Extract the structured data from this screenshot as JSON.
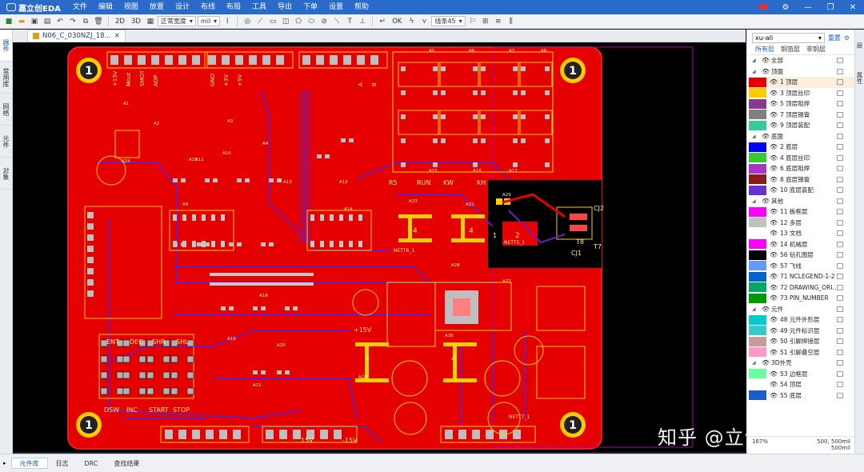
{
  "app": {
    "name": "嘉立创EDA"
  },
  "menu": [
    "文件",
    "编辑",
    "视图",
    "放置",
    "设计",
    "布线",
    "布局",
    "工具",
    "导出",
    "下单",
    "设置",
    "帮助"
  ],
  "toolbar": {
    "view2d": "2D",
    "view3d": "3D",
    "mode": "正常宽度",
    "unit": "mil",
    "track": "线条45"
  },
  "document_tab": {
    "title": "N06_C_030NZJ_18..."
  },
  "left_tabs": [
    "器件",
    "常用库",
    "网络",
    "元件",
    "对象"
  ],
  "right_tabs_side": [
    "层",
    "属性"
  ],
  "layers_panel": {
    "preset": "xu-all",
    "reset": "重置",
    "tabs": [
      "所有层",
      "铜箔层",
      "非铜层"
    ],
    "rows": [
      {
        "type": "group",
        "name": "全部"
      },
      {
        "type": "group",
        "name": "顶面"
      },
      {
        "type": "layer",
        "name": "1 顶层",
        "color": "#e60000",
        "active": true
      },
      {
        "type": "layer",
        "name": "3 顶层丝印",
        "color": "#ffcc00"
      },
      {
        "type": "layer",
        "name": "5 顶层阻焊",
        "color": "#8b3a8b"
      },
      {
        "type": "layer",
        "name": "7 顶层锡膏",
        "color": "#808080"
      },
      {
        "type": "layer",
        "name": "9 顶层装配",
        "color": "#33cc99"
      },
      {
        "type": "group",
        "name": "底面"
      },
      {
        "type": "layer",
        "name": "2 底层",
        "color": "#0000ff"
      },
      {
        "type": "layer",
        "name": "4 底层丝印",
        "color": "#33cc33"
      },
      {
        "type": "layer",
        "name": "6 底层阻焊",
        "color": "#aa33cc"
      },
      {
        "type": "layer",
        "name": "8 底层锡膏",
        "color": "#8b1a1a"
      },
      {
        "type": "layer",
        "name": "10 底层装配",
        "color": "#6633cc"
      },
      {
        "type": "group",
        "name": "其他"
      },
      {
        "type": "layer",
        "name": "11 板框层",
        "color": "#ff00ff"
      },
      {
        "type": "layer",
        "name": "12 多层",
        "color": "#c0c0c0"
      },
      {
        "type": "layer",
        "name": "13 文档",
        "color": "#ffffff"
      },
      {
        "type": "layer",
        "name": "14 机械层",
        "color": "#ff00ff"
      },
      {
        "type": "layer",
        "name": "56 钻孔图层",
        "color": "#000000"
      },
      {
        "type": "layer",
        "name": "57 飞线",
        "color": "#6699ff"
      },
      {
        "type": "layer",
        "name": "71 NCLEGEND-1-2",
        "color": "#0066cc"
      },
      {
        "type": "layer",
        "name": "72 DRAWING_ORI...",
        "color": "#00aa66"
      },
      {
        "type": "layer",
        "name": "73 PIN_NUMBER",
        "color": "#009900"
      },
      {
        "type": "group",
        "name": "元件"
      },
      {
        "type": "layer",
        "name": "48 元件外形层",
        "color": "#00cccc"
      },
      {
        "type": "layer",
        "name": "49 元件标识层",
        "color": "#33cccc"
      },
      {
        "type": "layer",
        "name": "50 引脚焊接层",
        "color": "#cc9999"
      },
      {
        "type": "layer",
        "name": "51 引脚叠空层",
        "color": "#ff99cc"
      },
      {
        "type": "group",
        "name": "3D外壳"
      },
      {
        "type": "layer",
        "name": "53 边框层",
        "color": "#66ff99"
      },
      {
        "type": "layer",
        "name": "54 顶层",
        "color": "#ffffff"
      },
      {
        "type": "layer",
        "name": "55 底层",
        "color": "#1a5fc8"
      }
    ],
    "status": {
      "zoom": "167%",
      "coord": "500, 500mil",
      "dx": "500mil"
    }
  },
  "bottom_tabs": [
    "元件库",
    "日志",
    "DRC",
    "查找结果"
  ],
  "board": {
    "mount_hole": "1",
    "connector_labels": [
      "+15V",
      "Mout",
      "SMOT",
      "ADP",
      "GND",
      "+3V",
      "+5V",
      "A",
      "B"
    ],
    "top_labels": [
      "KW",
      "RUN",
      "KH",
      "R5"
    ],
    "button_labels": [
      "ENT",
      "DEC",
      "SHR",
      "SHL",
      "DSW",
      "INC",
      "START",
      "STOP"
    ],
    "right_labels": [
      "CJ2",
      "CJ1",
      "T7",
      "T8"
    ],
    "net_labels": [
      "NETT5_1",
      "NETT6_1",
      "NETT7_1"
    ],
    "designators": [
      "A1",
      "A2",
      "A3",
      "A4",
      "A5",
      "A6",
      "A7",
      "A8",
      "A9",
      "A10",
      "A11",
      "A12",
      "A13",
      "A14",
      "A15",
      "A16",
      "A17",
      "A18",
      "A19",
      "A20",
      "A21",
      "A22",
      "A23",
      "A24",
      "A25",
      "A26",
      "A27",
      "A28",
      "A29",
      "A30"
    ],
    "rail_labels": [
      "+15V",
      "15V",
      "-15V"
    ],
    "pad_numbers": [
      "1",
      "2",
      "4"
    ]
  },
  "watermark": "知乎 @立创EDA"
}
